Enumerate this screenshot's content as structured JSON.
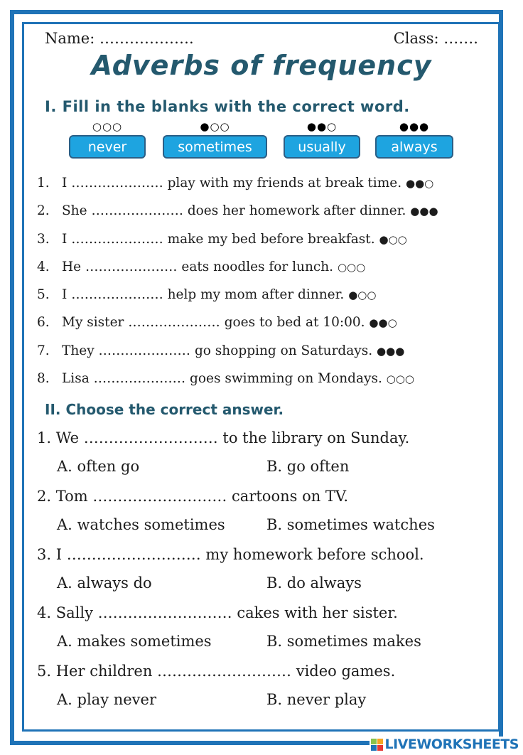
{
  "header": {
    "name_label": "Name: ……………….",
    "class_label": "Class: ……."
  },
  "title": "Adverbs of frequency",
  "section1": {
    "title": "I. Fill in the blanks with the correct word.",
    "word_bank": [
      {
        "word": "never",
        "dots": "○○○"
      },
      {
        "word": "sometimes",
        "dots": "●○○"
      },
      {
        "word": "usually",
        "dots": "●●○"
      },
      {
        "word": "always",
        "dots": "●●●"
      }
    ],
    "items": [
      {
        "num": "1.",
        "subject": "I",
        "blank": "…………………",
        "rest": "play with my friends at break time.",
        "dots": "●●○"
      },
      {
        "num": "2.",
        "subject": "She",
        "blank": "…………………",
        "rest": "does her homework after dinner.",
        "dots": "●●●"
      },
      {
        "num": "3.",
        "subject": "I",
        "blank": "…………………",
        "rest": "make my bed before breakfast.",
        "dots": "●○○"
      },
      {
        "num": "4.",
        "subject": "He",
        "blank": "…………………",
        "rest": "eats noodles for lunch.",
        "dots": "○○○"
      },
      {
        "num": "5.",
        "subject": "I",
        "blank": "…………………",
        "rest": "help my mom after dinner.",
        "dots": "●○○"
      },
      {
        "num": "6.",
        "subject": "My sister",
        "blank": "…………………",
        "rest": "goes to bed at 10:00.",
        "dots": "●●○"
      },
      {
        "num": "7.",
        "subject": "They",
        "blank": "…………………",
        "rest": "go shopping on Saturdays.",
        "dots": "●●●"
      },
      {
        "num": "8.",
        "subject": "Lisa",
        "blank": "…………………",
        "rest": "goes swimming on Mondays.",
        "dots": "○○○"
      }
    ]
  },
  "section2": {
    "title": "II. Choose the correct answer.",
    "questions": [
      {
        "num": "1.",
        "subject": "We",
        "blank": "………………………",
        "rest": "to the library on Sunday.",
        "a": "A. often go",
        "b": "B. go often"
      },
      {
        "num": "2.",
        "subject": "Tom",
        "blank": "………………………",
        "rest": "cartoons on TV.",
        "a": "A. watches sometimes",
        "b": "B. sometimes watches"
      },
      {
        "num": "3.",
        "subject": "I",
        "blank": "………………………",
        "rest": "my homework before school.",
        "a": "A. always do",
        "b": "B. do always"
      },
      {
        "num": "4.",
        "subject": "Sally",
        "blank": "………………………",
        "rest": "cakes with her sister.",
        "a": "A. makes sometimes",
        "b": "B. sometimes makes"
      },
      {
        "num": "5.",
        "subject": "Her children",
        "blank": "………………………",
        "rest": "video games.",
        "a": "A. play never",
        "b": "B. never play"
      }
    ]
  },
  "logo": {
    "text": "LIVEWORKSHEETS",
    "icon_colors": [
      "#8bc34a",
      "#f5a623",
      "#1f73b7",
      "#e53935"
    ]
  }
}
